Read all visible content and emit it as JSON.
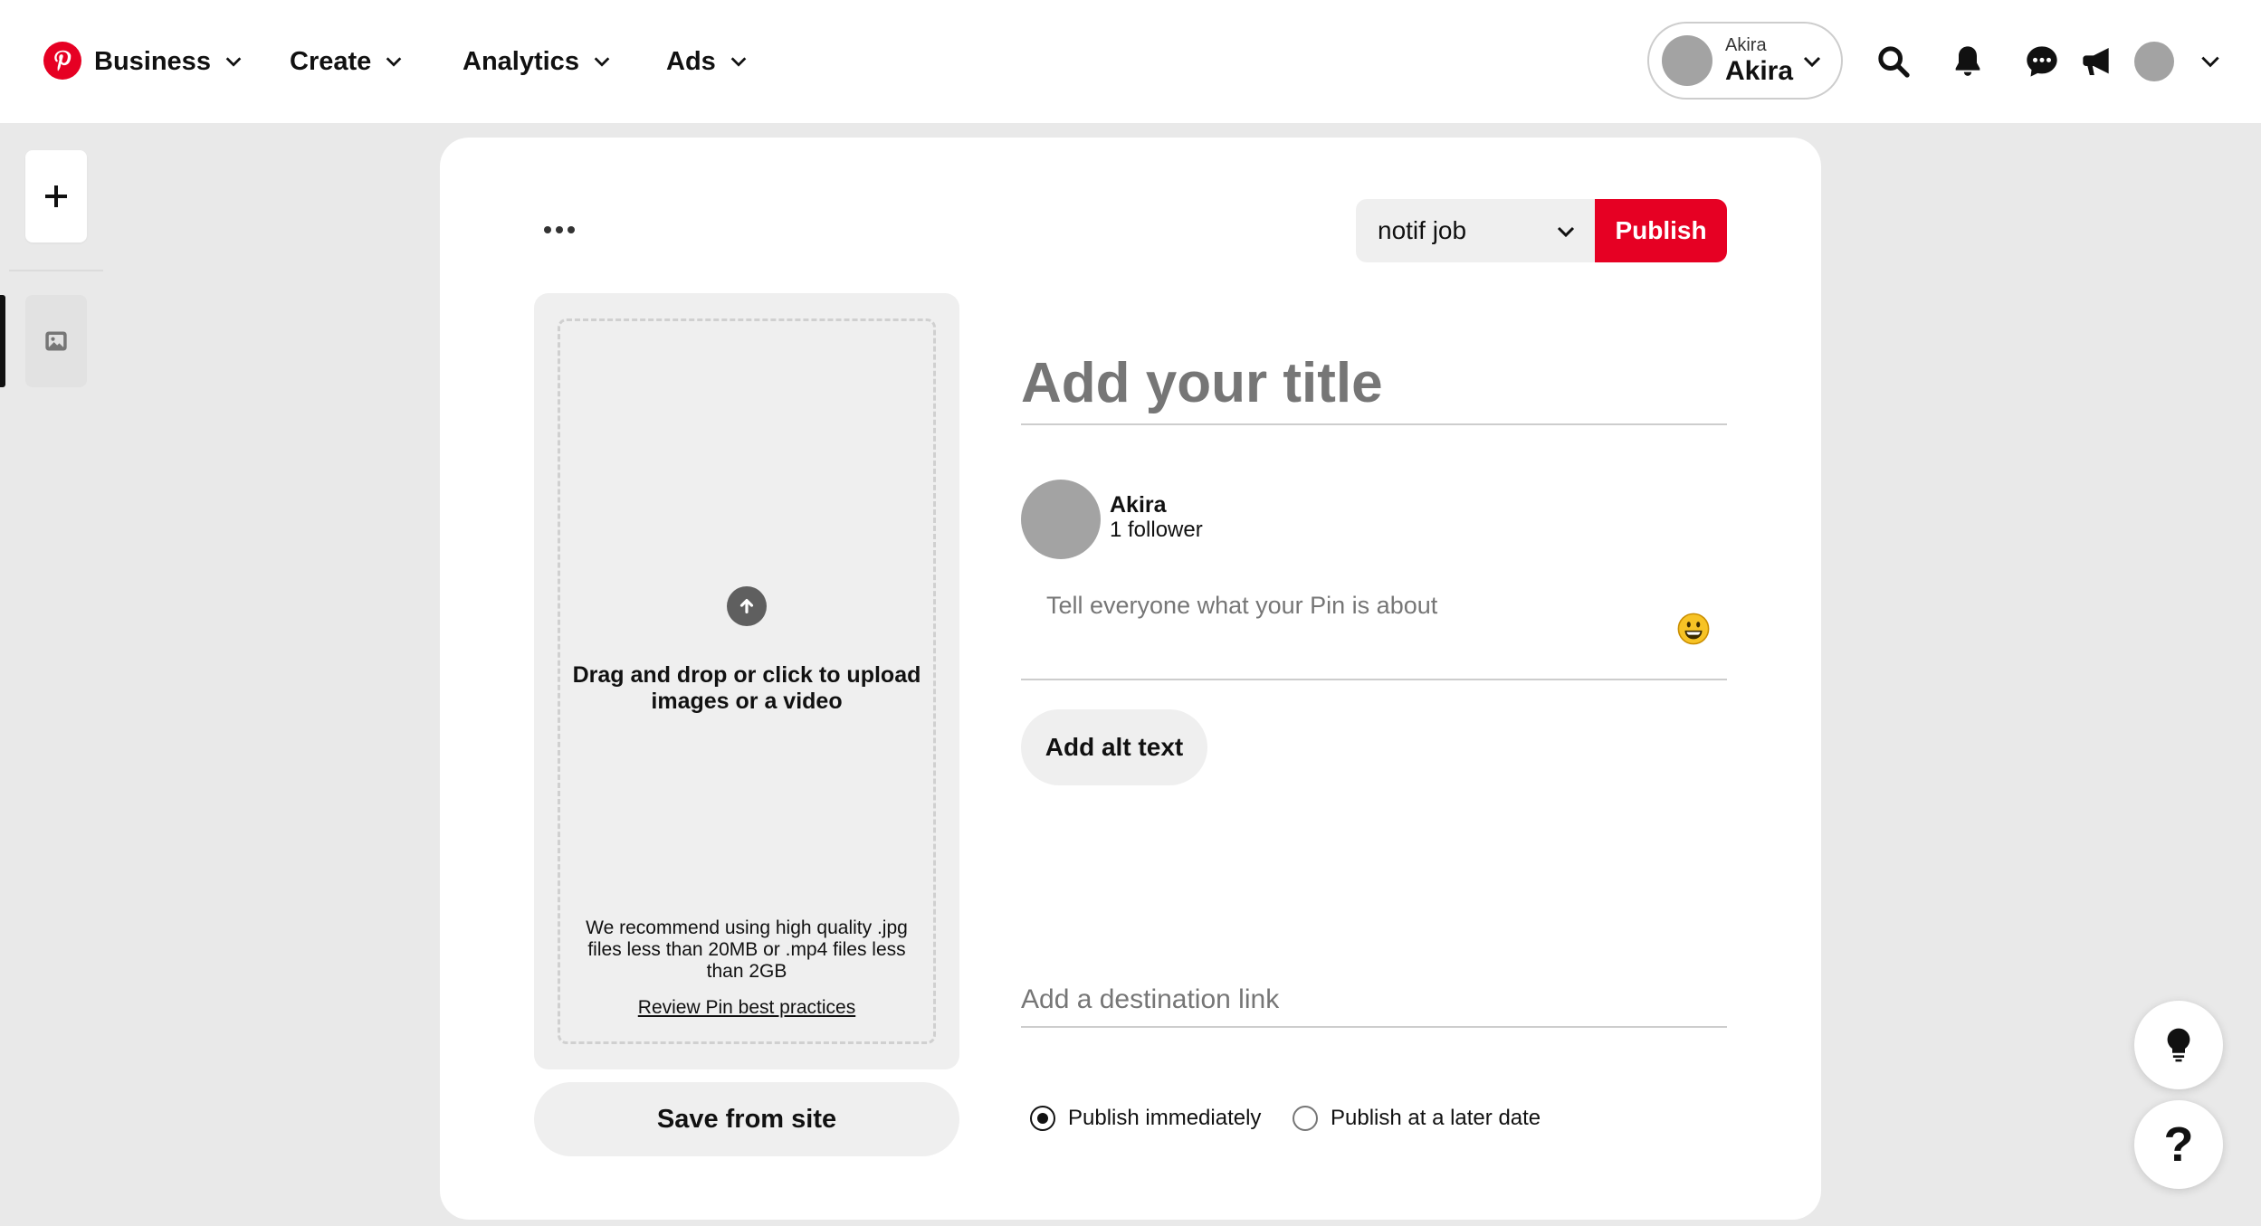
{
  "brand": {
    "accent": "#e60023"
  },
  "nav": {
    "business": "Business",
    "create": "Create",
    "analytics": "Analytics",
    "ads": "Ads"
  },
  "account": {
    "label_small": "Akira",
    "label_big": "Akira"
  },
  "toolbar_icons": [
    "search-icon",
    "bell-icon",
    "messages-icon",
    "megaphone-icon"
  ],
  "board_select": {
    "value": "notif job"
  },
  "publish_label": "Publish",
  "upload": {
    "main_text": "Drag and drop or click to upload images or a video",
    "recommend_text": "We recommend using high quality .jpg files less than 20MB or .mp4 files less than 2GB",
    "review_link": "Review Pin best practices"
  },
  "save_from_site": "Save from site",
  "title_placeholder": "Add your title",
  "user": {
    "name": "Akira",
    "followers": "1 follower"
  },
  "description_placeholder": "Tell everyone what your Pin is about",
  "alt_text_button": "Add alt text",
  "destination_placeholder": "Add a destination link",
  "publish_options": {
    "immediately": "Publish immediately",
    "later": "Publish at a later date",
    "selected": "immediately"
  },
  "help": {
    "question_mark": "?"
  }
}
